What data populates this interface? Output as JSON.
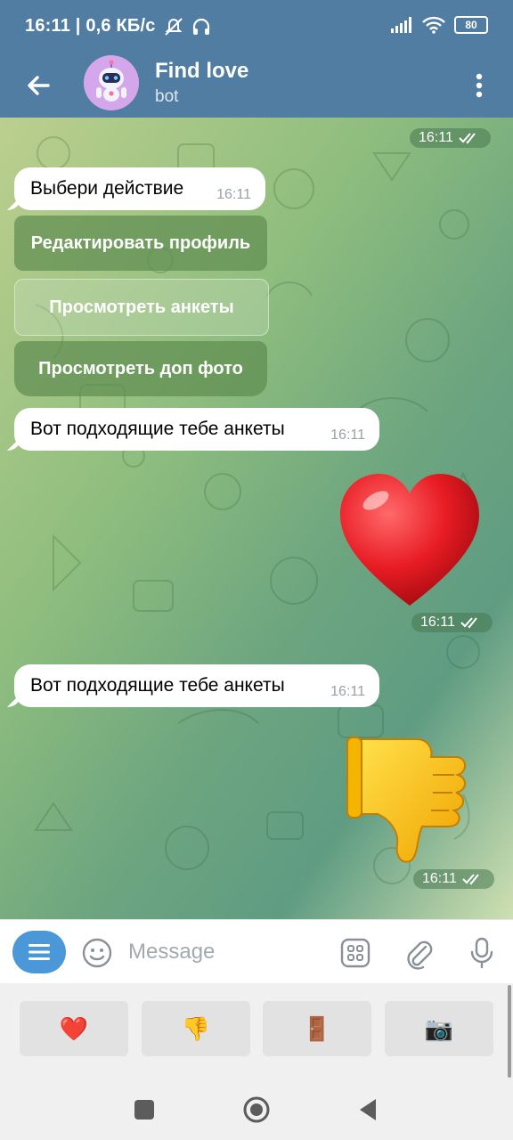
{
  "status_bar": {
    "time_speed": "16:11 | 0,6 КБ/с",
    "battery": "80"
  },
  "header": {
    "title": "Find love",
    "subtitle": "bot"
  },
  "messages": [
    {
      "type": "outgoing-time",
      "time": "16:11"
    },
    {
      "type": "incoming",
      "text": "Выбери действие",
      "time": "16:11"
    },
    {
      "type": "keyboard",
      "buttons": [
        "Редактировать профиль",
        "Просмотреть анкеты",
        "Просмотреть доп фото"
      ]
    },
    {
      "type": "incoming",
      "text": "Вот подходящие тебе анкеты",
      "time": "16:11"
    },
    {
      "type": "sticker",
      "emoji": "❤️",
      "time": "16:11"
    },
    {
      "type": "incoming",
      "text": "Вот подходящие тебе анкеты",
      "time": "16:11"
    },
    {
      "type": "sticker",
      "emoji": "👎",
      "time": "16:11"
    }
  ],
  "composer": {
    "placeholder": "Message"
  },
  "bot_keyboard": [
    "❤️",
    "👎",
    "🚪",
    "📷"
  ]
}
